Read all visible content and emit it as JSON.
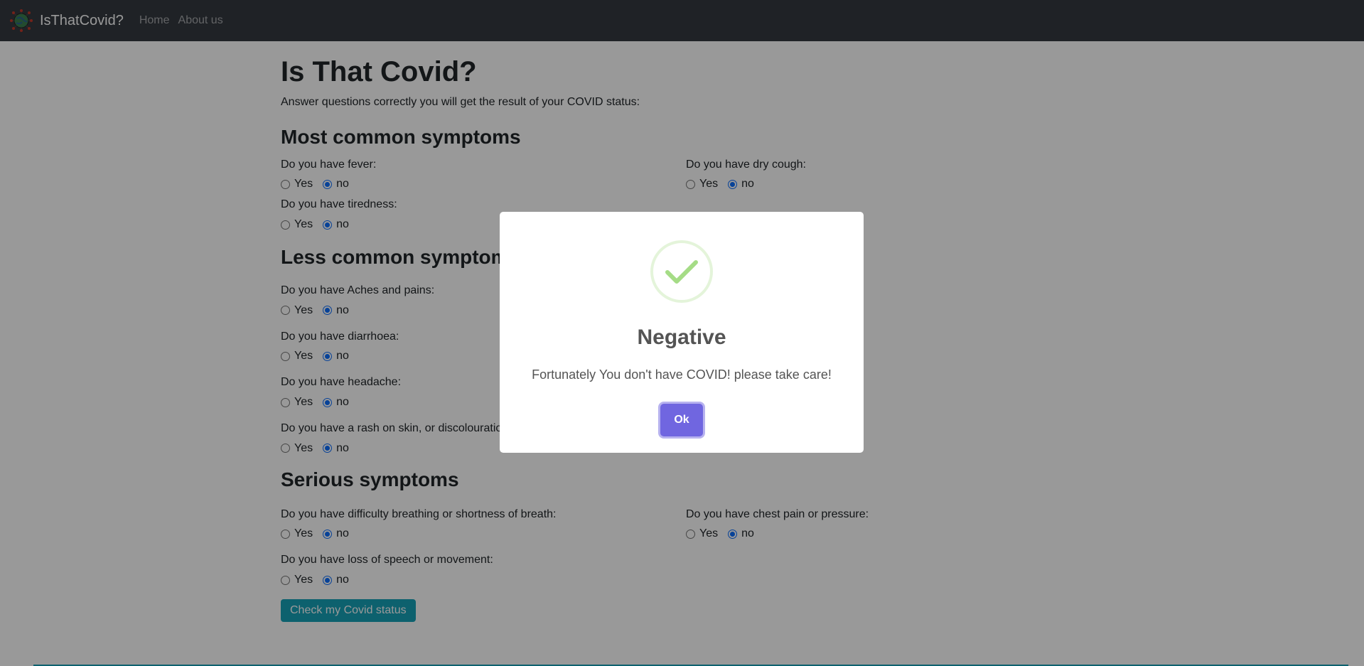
{
  "navbar": {
    "brand": "IsThatCovid?",
    "logo_icon": "virus-globe-icon",
    "links": [
      "Home",
      "About us"
    ]
  },
  "page": {
    "title": "Is That Covid?",
    "subtitle": "Answer questions correctly you will get the result of your COVID status:"
  },
  "sections": [
    {
      "title": "Most common symptoms",
      "questions": [
        {
          "label": "Do you have fever:",
          "yes": "Yes",
          "no": "no",
          "selected": "no"
        },
        {
          "label": "Do you have dry cough:",
          "yes": "Yes",
          "no": "no",
          "selected": "no"
        },
        {
          "label": "Do you have tiredness:",
          "yes": "Yes",
          "no": "no",
          "selected": "no"
        }
      ]
    },
    {
      "title": "Less common symptoms",
      "questions": [
        {
          "label": "Do you have Aches and pains:",
          "yes": "Yes",
          "no": "no",
          "selected": "no"
        },
        {
          "label": "Do you have diarrhoea:",
          "yes": "Yes",
          "no": "no",
          "selected": "no"
        },
        {
          "label": "Do you have headache:",
          "yes": "Yes",
          "no": "no",
          "selected": "no"
        },
        {
          "label": "Do you have a rash on skin, or discolouration of fingers or toes:",
          "yes": "Yes",
          "no": "no",
          "selected": "no"
        }
      ]
    },
    {
      "title": "Serious symptoms",
      "questions": [
        {
          "label": "Do you have difficulty breathing or shortness of breath:",
          "yes": "Yes",
          "no": "no",
          "selected": "no"
        },
        {
          "label": "Do you have chest pain or pressure:",
          "yes": "Yes",
          "no": "no",
          "selected": "no"
        },
        {
          "label": "Do you have loss of speech or movement:",
          "yes": "Yes",
          "no": "no",
          "selected": "no"
        }
      ]
    }
  ],
  "submit_label": "Check my Covid status",
  "modal": {
    "icon": "success-check-icon",
    "title": "Negative",
    "text": "Fortunately You don't have COVID! please take care!",
    "ok_label": "Ok"
  },
  "colors": {
    "navbar": "#343a40",
    "submit": "#17a2b8",
    "ok_button": "#7066e0",
    "success_check": "#a5dc86"
  }
}
